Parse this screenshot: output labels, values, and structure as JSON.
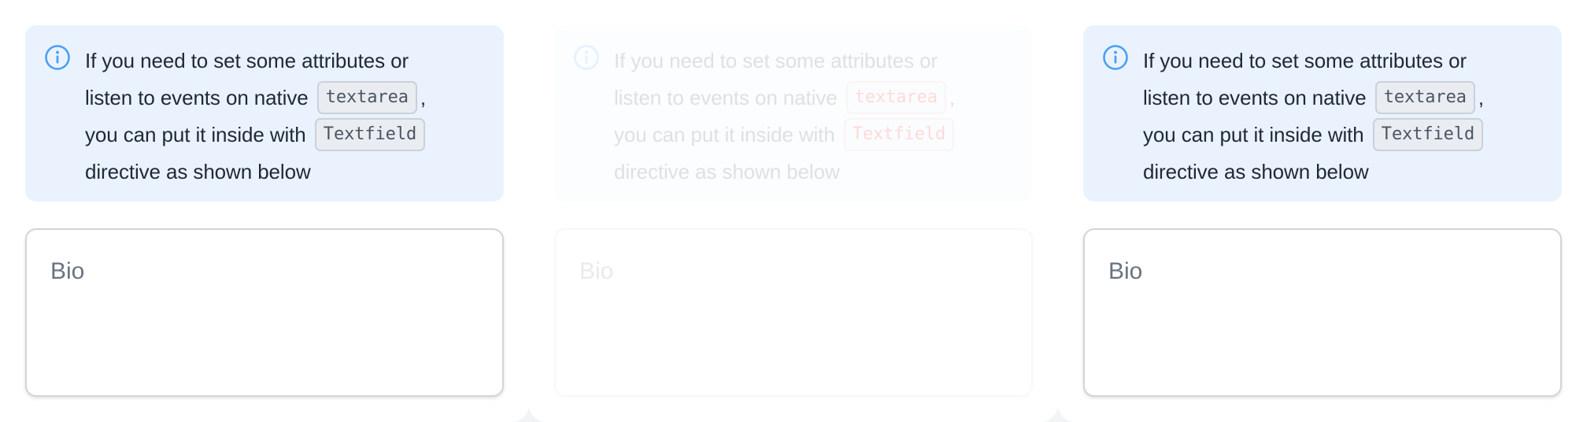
{
  "panels": [
    {
      "alert": {
        "icon": "info-icon",
        "line1": "If you need to set some attributes or",
        "line2_pre": "listen to events on native",
        "code1": "textarea",
        "line2_post": ",",
        "line3_pre": "you can put it inside with",
        "code2": "Textfield",
        "line4": "directive as shown below"
      },
      "textarea": {
        "placeholder": "Bio"
      }
    },
    {
      "alert": {
        "icon": "info-icon",
        "line1": "If you need to set some attributes or",
        "line2_pre": "listen to events on native",
        "code1": "textarea",
        "line2_post": ",",
        "line3_pre": "you can put it inside with",
        "code2": "Textfield",
        "line4": "directive as shown below"
      },
      "textarea": {
        "placeholder": "Bio"
      }
    },
    {
      "alert": {
        "icon": "info-icon",
        "line1": "If you need to set some attributes or",
        "line2_pre": "listen to events on native",
        "code1": "textarea",
        "line2_post": ",",
        "line3_pre": "you can put it inside with",
        "code2": "Textfield",
        "line4": "directive as shown below"
      },
      "textarea": {
        "placeholder": "Bio"
      }
    }
  ],
  "colors": {
    "alert_bg": "#eaf3fd",
    "info_icon": "#4a9ff5",
    "text": "#1f2937",
    "placeholder": "#6b7280"
  }
}
